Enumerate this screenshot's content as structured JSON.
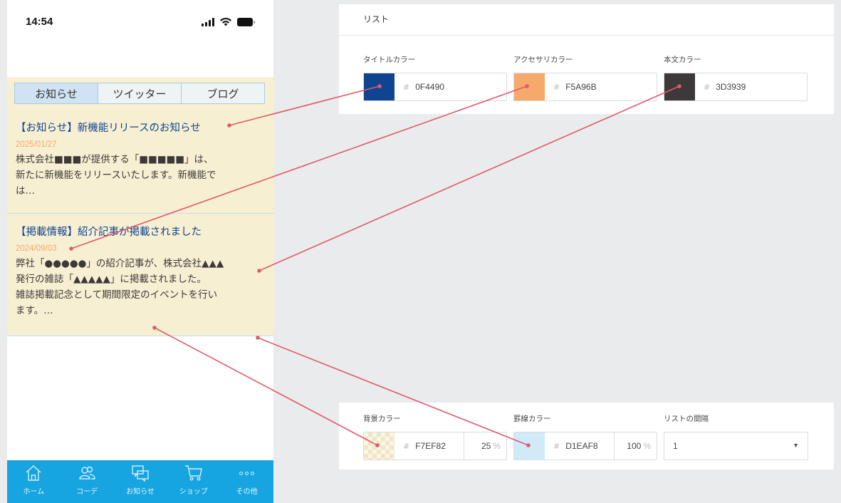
{
  "phone": {
    "status": {
      "time": "14:54"
    },
    "tabs": [
      {
        "label": "お知らせ"
      },
      {
        "label": "ツイッター"
      },
      {
        "label": "ブログ"
      }
    ],
    "articles": [
      {
        "title": "【お知らせ】新機能リリースのお知らせ",
        "date": "2025/01/27",
        "body": [
          "株式会社■■■が提供する「■■■■■」は、",
          "新たに新機能をリリースいたします。新機能で",
          "は…"
        ]
      },
      {
        "title": "【掲載情報】紹介記事が掲載されました",
        "date": "2024/09/03",
        "body": [
          "弊社「●●●●●」の紹介記事が、株式会社▲▲▲",
          "発行の雑誌「▲▲▲▲▲」に掲載されました。",
          "雑誌掲載記念として期間限定のイベントを行い",
          "ます。…"
        ]
      }
    ],
    "tabbar": [
      {
        "label": "ホーム",
        "icon": "home-icon"
      },
      {
        "label": "コーデ",
        "icon": "people-icon"
      },
      {
        "label": "お知らせ",
        "icon": "chat-icon"
      },
      {
        "label": "ショップ",
        "icon": "cart-icon"
      },
      {
        "label": "その他",
        "icon": "more-dots-icon"
      }
    ],
    "colors": {
      "title": "#0F4490",
      "accent": "#F5A96B",
      "body": "#3D3939",
      "background": "#F7EF82",
      "border": "#D1EAF8",
      "tabbar": "#16A5E0"
    }
  },
  "settings": {
    "list_header": "リスト",
    "title_color": {
      "label": "タイトルカラー",
      "hash": "#",
      "value": "0F4490",
      "swatch": "#0F4490"
    },
    "accent_color": {
      "label": "アクセサリカラー",
      "hash": "#",
      "value": "F5A96B",
      "swatch": "#F5A96B"
    },
    "body_color": {
      "label": "本文カラー",
      "hash": "#",
      "value": "3D3939",
      "swatch": "#3D3939"
    },
    "bg_color": {
      "label": "背景カラー",
      "hash": "#",
      "value": "F7EF82",
      "alpha": "25",
      "pct": "%"
    },
    "border_color": {
      "label": "罫線カラー",
      "hash": "#",
      "value": "D1EAF8",
      "alpha": "100",
      "pct": "%",
      "swatch": "#D1EAF8"
    },
    "spacing": {
      "label": "リストの間隔",
      "value": "1",
      "arrow": "▼"
    }
  }
}
